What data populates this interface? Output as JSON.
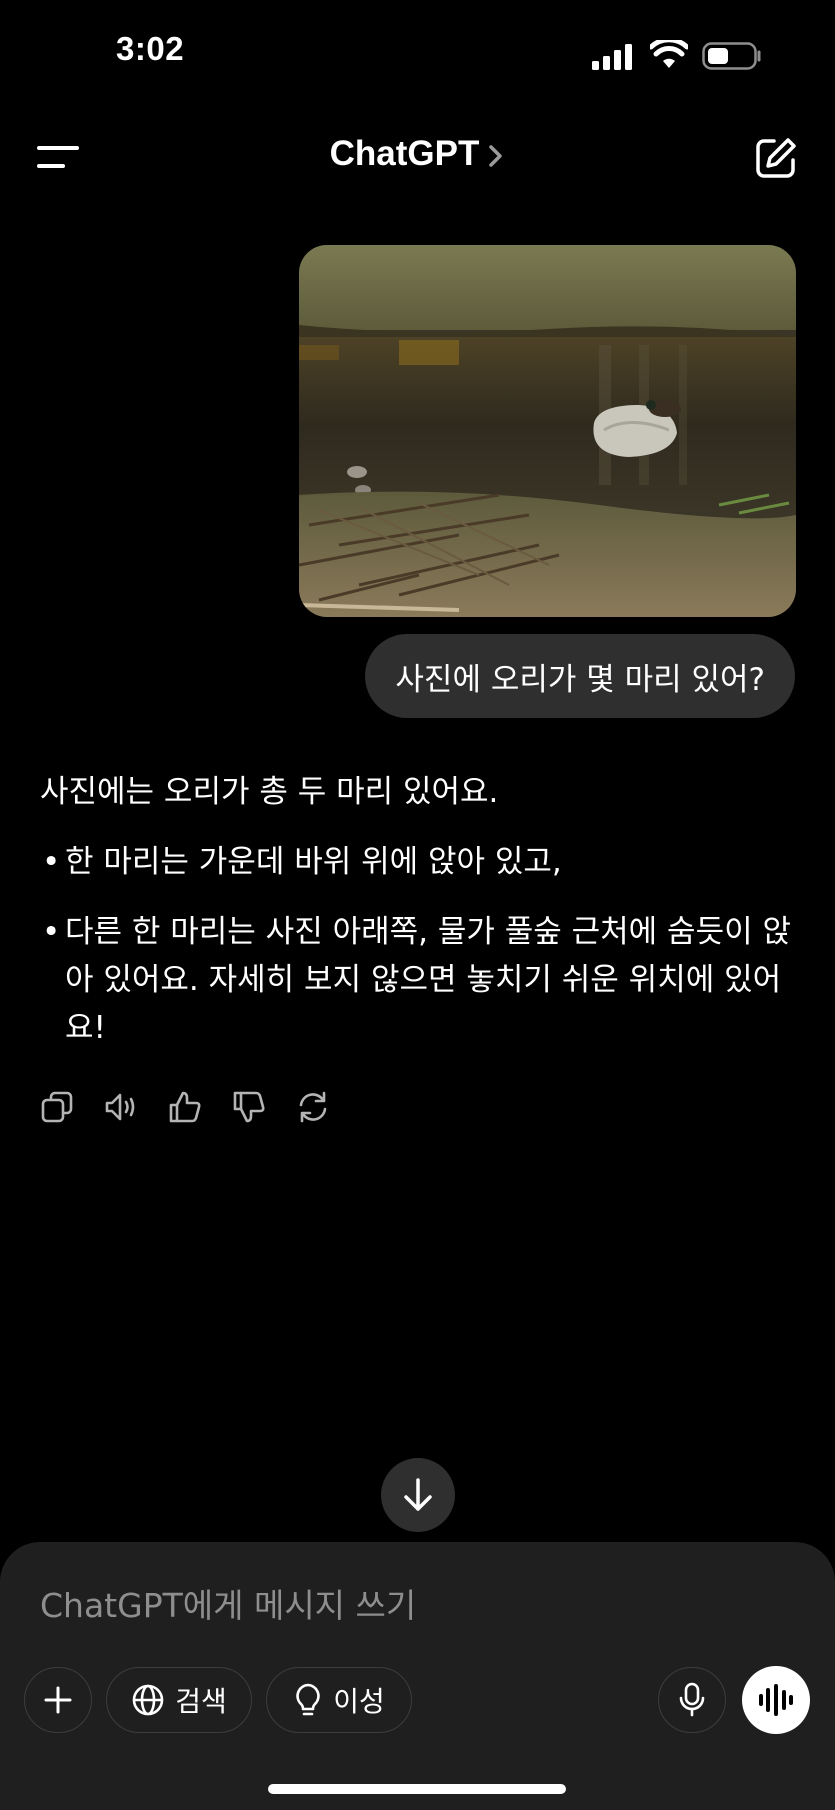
{
  "status_bar": {
    "time": "3:02",
    "icons": [
      "cellular-signal-icon",
      "wifi-icon",
      "battery-icon"
    ]
  },
  "header": {
    "title": "ChatGPT",
    "icons": [
      "menu-icon",
      "chevron-right-icon",
      "new-chat-icon"
    ]
  },
  "conversation": {
    "user_message": {
      "image_description_icon": "photo-thumbnail",
      "text": "사진에 오리가 몇 마리 있어?"
    },
    "assistant_message": {
      "intro": "사진에는 오리가 총 두 마리 있어요.",
      "bullet_char": "•",
      "bullets": [
        "한 마리는 가운데 바위 위에 앉아 있고,",
        "다른 한 마리는 사진 아래쪽, 물가 풀숲 근처에 숨듯이 앉아 있어요. 자세히 보지 않으면 놓치기 쉬운 위치에 있어요!"
      ],
      "action_icons": [
        "copy-icon",
        "read-aloud-icon",
        "thumbs-up-icon",
        "thumbs-down-icon",
        "regenerate-icon"
      ]
    }
  },
  "scroll_down_icon": "arrow-down-icon",
  "composer": {
    "placeholder": "ChatGPT에게 메시지 쓰기",
    "search_label": "검색",
    "reason_label": "이성",
    "icons": [
      "plus-icon",
      "globe-icon",
      "lightbulb-icon",
      "microphone-icon",
      "voice-mode-icon"
    ]
  },
  "colors": {
    "background": "#000000",
    "bubble": "#2f2f2f",
    "composer": "#1f1f1f",
    "placeholder": "#8e8e8e"
  }
}
